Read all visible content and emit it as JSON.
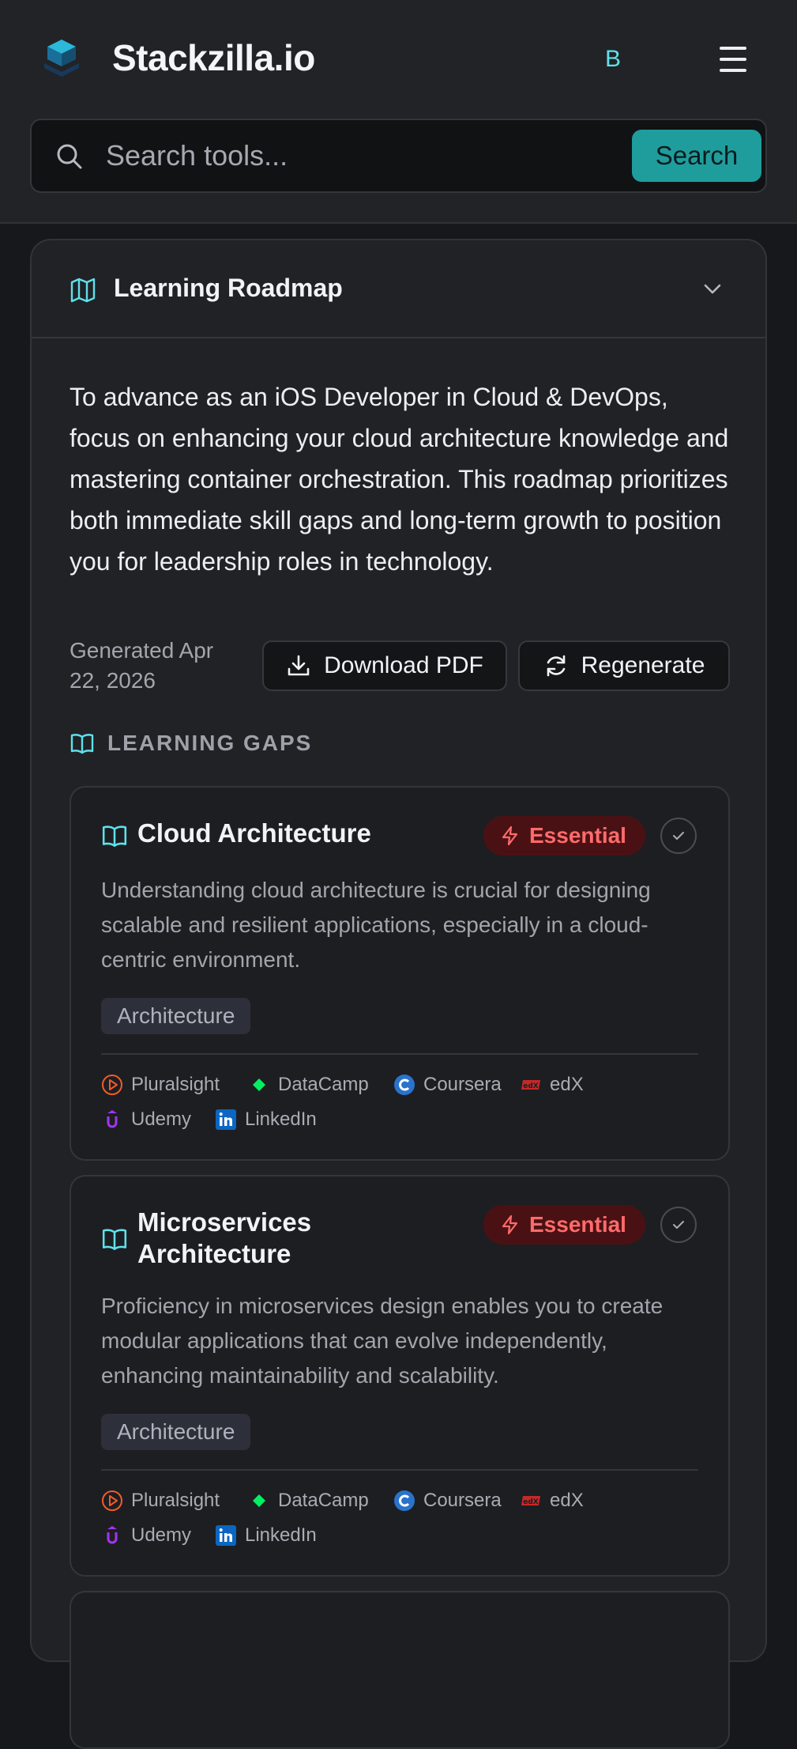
{
  "header": {
    "brand": "Stackzilla.io",
    "avatar_letter": "B",
    "search": {
      "placeholder": "Search tools...",
      "value": "",
      "button_label": "Search"
    }
  },
  "roadmap": {
    "title": "Learning Roadmap",
    "summary": "To advance as an iOS Developer in Cloud & DevOps, focus on enhancing your cloud architecture knowledge and mastering container orchestration. This roadmap prioritizes both immediate skill gaps and long-term growth to position you for leadership roles in technology.",
    "generated": "Generated Apr 22, 2026",
    "download_label": "Download PDF",
    "regenerate_label": "Regenerate",
    "section_label": "LEARNING GAPS",
    "gaps": [
      {
        "title": "Cloud Architecture",
        "badge": "Essential",
        "description": "Understanding cloud architecture is crucial for designing scalable and resilient applications, especially in a cloud-centric environment.",
        "tag": "Architecture",
        "providers": [
          "Pluralsight",
          "DataCamp",
          "Coursera",
          "edX",
          "Udemy",
          "LinkedIn"
        ]
      },
      {
        "title": "Microservices Architecture",
        "badge": "Essential",
        "description": "Proficiency in microservices design enables you to create modular applications that can evolve independently, enhancing maintainability and scalability.",
        "tag": "Architecture",
        "providers": [
          "Pluralsight",
          "DataCamp",
          "Coursera",
          "edX",
          "Udemy",
          "LinkedIn"
        ]
      }
    ]
  },
  "colors": {
    "accent": "#5ee1ea",
    "search_button": "#1f9d9d",
    "badge_bg": "#4a1114",
    "badge_text": "#ff6b6b"
  }
}
